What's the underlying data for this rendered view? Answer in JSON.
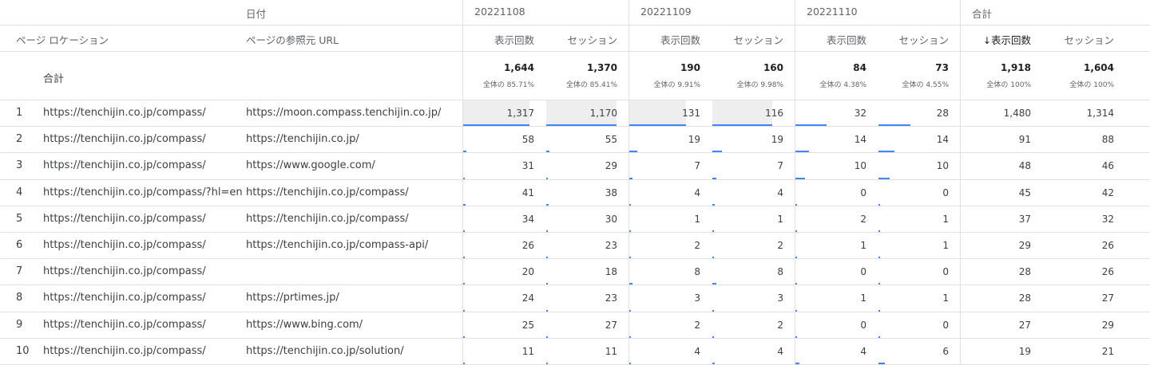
{
  "header": {
    "date_label": "日付",
    "dates": [
      "20221108",
      "20221109",
      "20221110"
    ],
    "total_label": "合計",
    "col_page_location": "ページ ロケーション",
    "col_referrer": "ページの参照元 URL",
    "metric_views": "表示回数",
    "metric_sessions": "セッション",
    "sort_arrow": "↓"
  },
  "totals_row": {
    "label": "合計",
    "values": [
      {
        "main": "1,644",
        "sub": "全体の 85.71%"
      },
      {
        "main": "1,370",
        "sub": "全体の 85.41%"
      },
      {
        "main": "190",
        "sub": "全体の 9.91%"
      },
      {
        "main": "160",
        "sub": "全体の 9.98%"
      },
      {
        "main": "84",
        "sub": "全体の 4.38%"
      },
      {
        "main": "73",
        "sub": "全体の 4.55%"
      },
      {
        "main": "1,918",
        "sub": "全体の 100%"
      },
      {
        "main": "1,604",
        "sub": "全体の 100%"
      }
    ]
  },
  "rows": [
    {
      "idx": "1",
      "loc": "https://tenchijin.co.jp/compass/",
      "ref": "https://moon.compass.tenchijin.co.jp/",
      "vals": [
        "1,317",
        "1,170",
        "131",
        "116",
        "32",
        "28",
        "1,480",
        "1,314"
      ]
    },
    {
      "idx": "2",
      "loc": "https://tenchijin.co.jp/compass/",
      "ref": "https://tenchijin.co.jp/",
      "vals": [
        "58",
        "55",
        "19",
        "19",
        "14",
        "14",
        "91",
        "88"
      ]
    },
    {
      "idx": "3",
      "loc": "https://tenchijin.co.jp/compass/",
      "ref": "https://www.google.com/",
      "vals": [
        "31",
        "29",
        "7",
        "7",
        "10",
        "10",
        "48",
        "46"
      ]
    },
    {
      "idx": "4",
      "loc": "https://tenchijin.co.jp/compass/?hl=en",
      "ref": "https://tenchijin.co.jp/compass/",
      "vals": [
        "41",
        "38",
        "4",
        "4",
        "0",
        "0",
        "45",
        "42"
      ]
    },
    {
      "idx": "5",
      "loc": "https://tenchijin.co.jp/compass/",
      "ref": "https://tenchijin.co.jp/compass/",
      "vals": [
        "34",
        "30",
        "1",
        "1",
        "2",
        "1",
        "37",
        "32"
      ]
    },
    {
      "idx": "6",
      "loc": "https://tenchijin.co.jp/compass/",
      "ref": "https://tenchijin.co.jp/compass-api/",
      "vals": [
        "26",
        "23",
        "2",
        "2",
        "1",
        "1",
        "29",
        "26"
      ]
    },
    {
      "idx": "7",
      "loc": "https://tenchijin.co.jp/compass/",
      "ref": "",
      "vals": [
        "20",
        "18",
        "8",
        "8",
        "0",
        "0",
        "28",
        "26"
      ]
    },
    {
      "idx": "8",
      "loc": "https://tenchijin.co.jp/compass/",
      "ref": "https://prtimes.jp/",
      "vals": [
        "24",
        "23",
        "3",
        "3",
        "1",
        "1",
        "28",
        "27"
      ]
    },
    {
      "idx": "9",
      "loc": "https://tenchijin.co.jp/compass/",
      "ref": "https://www.bing.com/",
      "vals": [
        "25",
        "27",
        "2",
        "2",
        "0",
        "0",
        "27",
        "29"
      ]
    },
    {
      "idx": "10",
      "loc": "https://tenchijin.co.jp/compass/",
      "ref": "https://tenchijin.co.jp/solution/",
      "vals": [
        "11",
        "11",
        "4",
        "4",
        "4",
        "6",
        "19",
        "21"
      ]
    }
  ],
  "colors": {
    "accent": "#4285f4",
    "grid": "#e0e0e0"
  }
}
